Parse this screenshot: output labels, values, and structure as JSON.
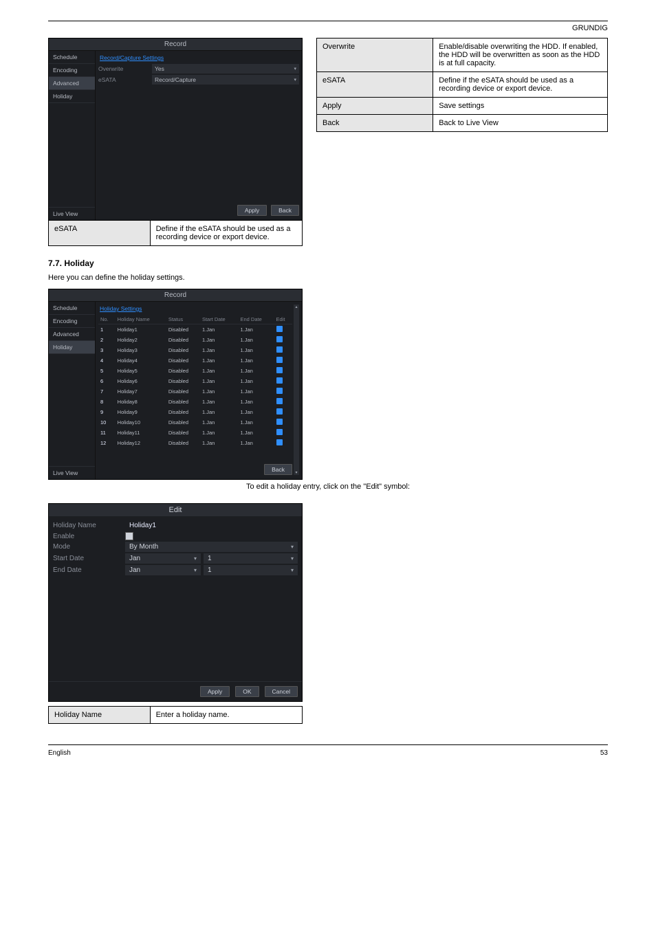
{
  "header_right": "GRUNDIG",
  "record_panel": {
    "title": "Record",
    "tab": "Record/Capture Settings",
    "sidebar": [
      "Schedule",
      "Encoding",
      "Advanced",
      "Holiday"
    ],
    "selected": "Advanced",
    "live_view": "Live View",
    "rows": [
      {
        "label": "Overwrite",
        "value": "Yes"
      },
      {
        "label": "eSATA",
        "value": "Record/Capture"
      }
    ],
    "buttons": {
      "apply": "Apply",
      "back": "Back"
    }
  },
  "advanced_params": [
    {
      "label": "Overwrite",
      "desc": "Enable/disable overwriting the HDD. If enabled, the HDD will be overwritten as soon as the HDD is at full capacity."
    },
    {
      "label": "eSATA",
      "desc": "Define if the eSATA should be used as a recording device or export device."
    },
    {
      "label": "Apply",
      "desc": "Save settings"
    },
    {
      "label": "Back",
      "desc": "Back to Live View"
    }
  ],
  "esata_under": {
    "label": "eSATA",
    "desc": "Define if the eSATA should be used as a recording device or export device."
  },
  "holiday_heading": "7.7. Holiday",
  "holiday_intro": "Here you can define the holiday settings.",
  "holiday_panel": {
    "title": "Record",
    "tab": "Holiday Settings",
    "sidebar": [
      "Schedule",
      "Encoding",
      "Advanced",
      "Holiday"
    ],
    "selected": "Holiday",
    "live_view": "Live View",
    "cols": {
      "no": "No.",
      "name": "Holiday Name",
      "status": "Status",
      "start": "Start Date",
      "end": "End Date",
      "edit": "Edit"
    },
    "rows": [
      {
        "n": "1",
        "name": "Holiday1",
        "status": "Disabled",
        "start": "1.Jan",
        "end": "1.Jan"
      },
      {
        "n": "2",
        "name": "Holiday2",
        "status": "Disabled",
        "start": "1.Jan",
        "end": "1.Jan"
      },
      {
        "n": "3",
        "name": "Holiday3",
        "status": "Disabled",
        "start": "1.Jan",
        "end": "1.Jan"
      },
      {
        "n": "4",
        "name": "Holiday4",
        "status": "Disabled",
        "start": "1.Jan",
        "end": "1.Jan"
      },
      {
        "n": "5",
        "name": "Holiday5",
        "status": "Disabled",
        "start": "1.Jan",
        "end": "1.Jan"
      },
      {
        "n": "6",
        "name": "Holiday6",
        "status": "Disabled",
        "start": "1.Jan",
        "end": "1.Jan"
      },
      {
        "n": "7",
        "name": "Holiday7",
        "status": "Disabled",
        "start": "1.Jan",
        "end": "1.Jan"
      },
      {
        "n": "8",
        "name": "Holiday8",
        "status": "Disabled",
        "start": "1.Jan",
        "end": "1.Jan"
      },
      {
        "n": "9",
        "name": "Holiday9",
        "status": "Disabled",
        "start": "1.Jan",
        "end": "1.Jan"
      },
      {
        "n": "10",
        "name": "Holiday10",
        "status": "Disabled",
        "start": "1.Jan",
        "end": "1.Jan"
      },
      {
        "n": "11",
        "name": "Holiday11",
        "status": "Disabled",
        "start": "1.Jan",
        "end": "1.Jan"
      },
      {
        "n": "12",
        "name": "Holiday12",
        "status": "Disabled",
        "start": "1.Jan",
        "end": "1.Jan"
      }
    ],
    "back": "Back"
  },
  "edit_caption": "To edit a holiday entry, click on the \"Edit\" symbol:",
  "edit_dialog": {
    "title": "Edit",
    "rows": {
      "holiday_name": {
        "label": "Holiday Name",
        "value": "Holiday1"
      },
      "enable": {
        "label": "Enable"
      },
      "mode": {
        "label": "Mode",
        "value": "By Month"
      },
      "start_date": {
        "label": "Start Date",
        "month": "Jan",
        "day": "1"
      },
      "end_date": {
        "label": "End Date",
        "month": "Jan",
        "day": "1"
      }
    },
    "buttons": {
      "apply": "Apply",
      "ok": "OK",
      "cancel": "Cancel"
    }
  },
  "edit_under": {
    "label": "Holiday Name",
    "desc": "Enter a holiday name."
  },
  "footer": {
    "left": "English",
    "right": "53"
  }
}
